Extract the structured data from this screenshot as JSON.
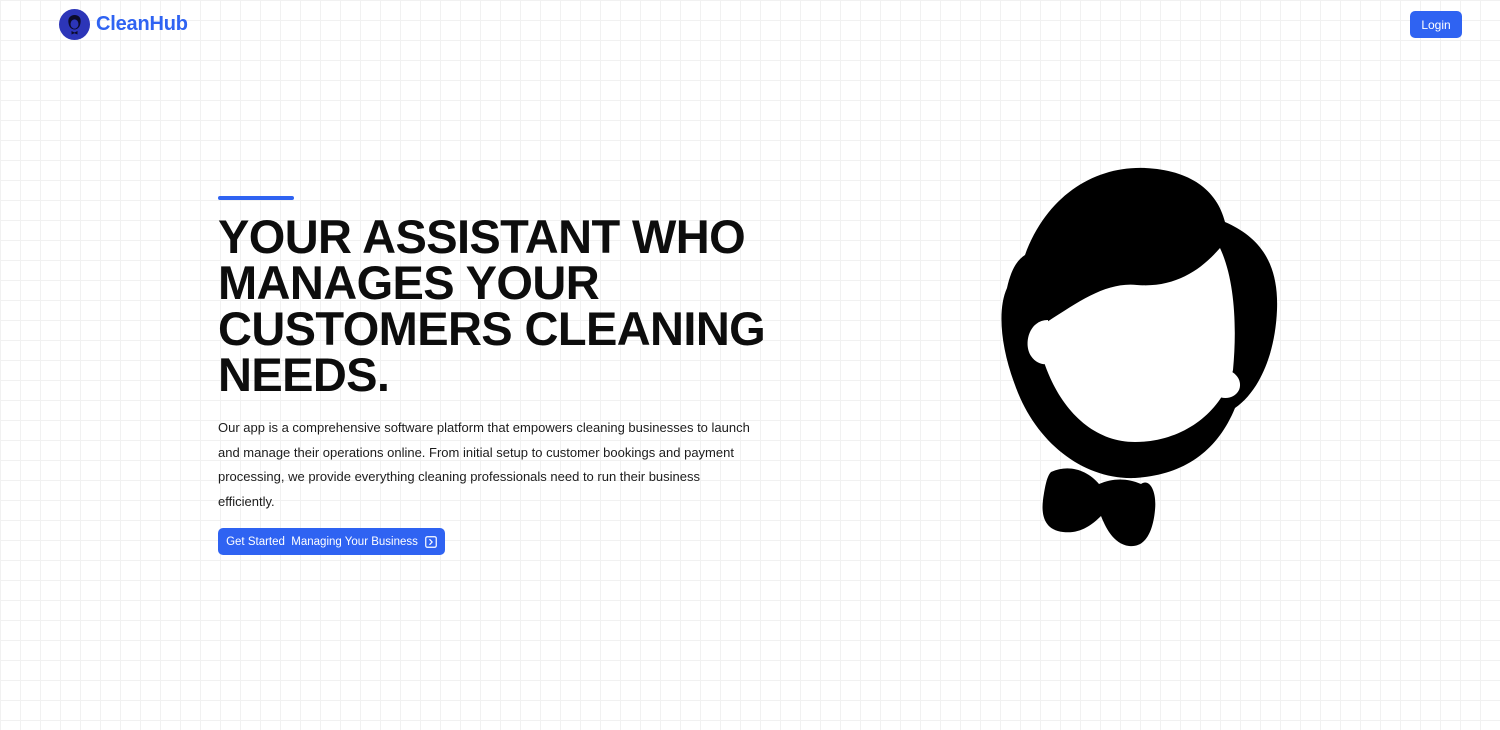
{
  "nav": {
    "brand_name": "CleanHub",
    "brand_icon": "butler-logo-icon",
    "login_label": "Login"
  },
  "hero": {
    "title": "YOUR ASSISTANT WHO\nMANAGES YOUR\nCUSTOMERS CLEANING\nNEEDS.",
    "description": "Our app is a comprehensive software platform that empowers cleaning businesses to launch and manage their operations online. From initial setup to customer bookings and payment processing, we provide everything cleaning professionals need to run their business efficiently.",
    "cta_label": "Get Started  Managing Your Business",
    "cta_icon": "arrow-square-right-icon",
    "illustration": "butler-silhouette-icon"
  },
  "colors": {
    "accent": "#2f63f2",
    "logo_bg": "#2c35b8",
    "text": "#0d0d0d",
    "grid": "#f1f1f1"
  }
}
